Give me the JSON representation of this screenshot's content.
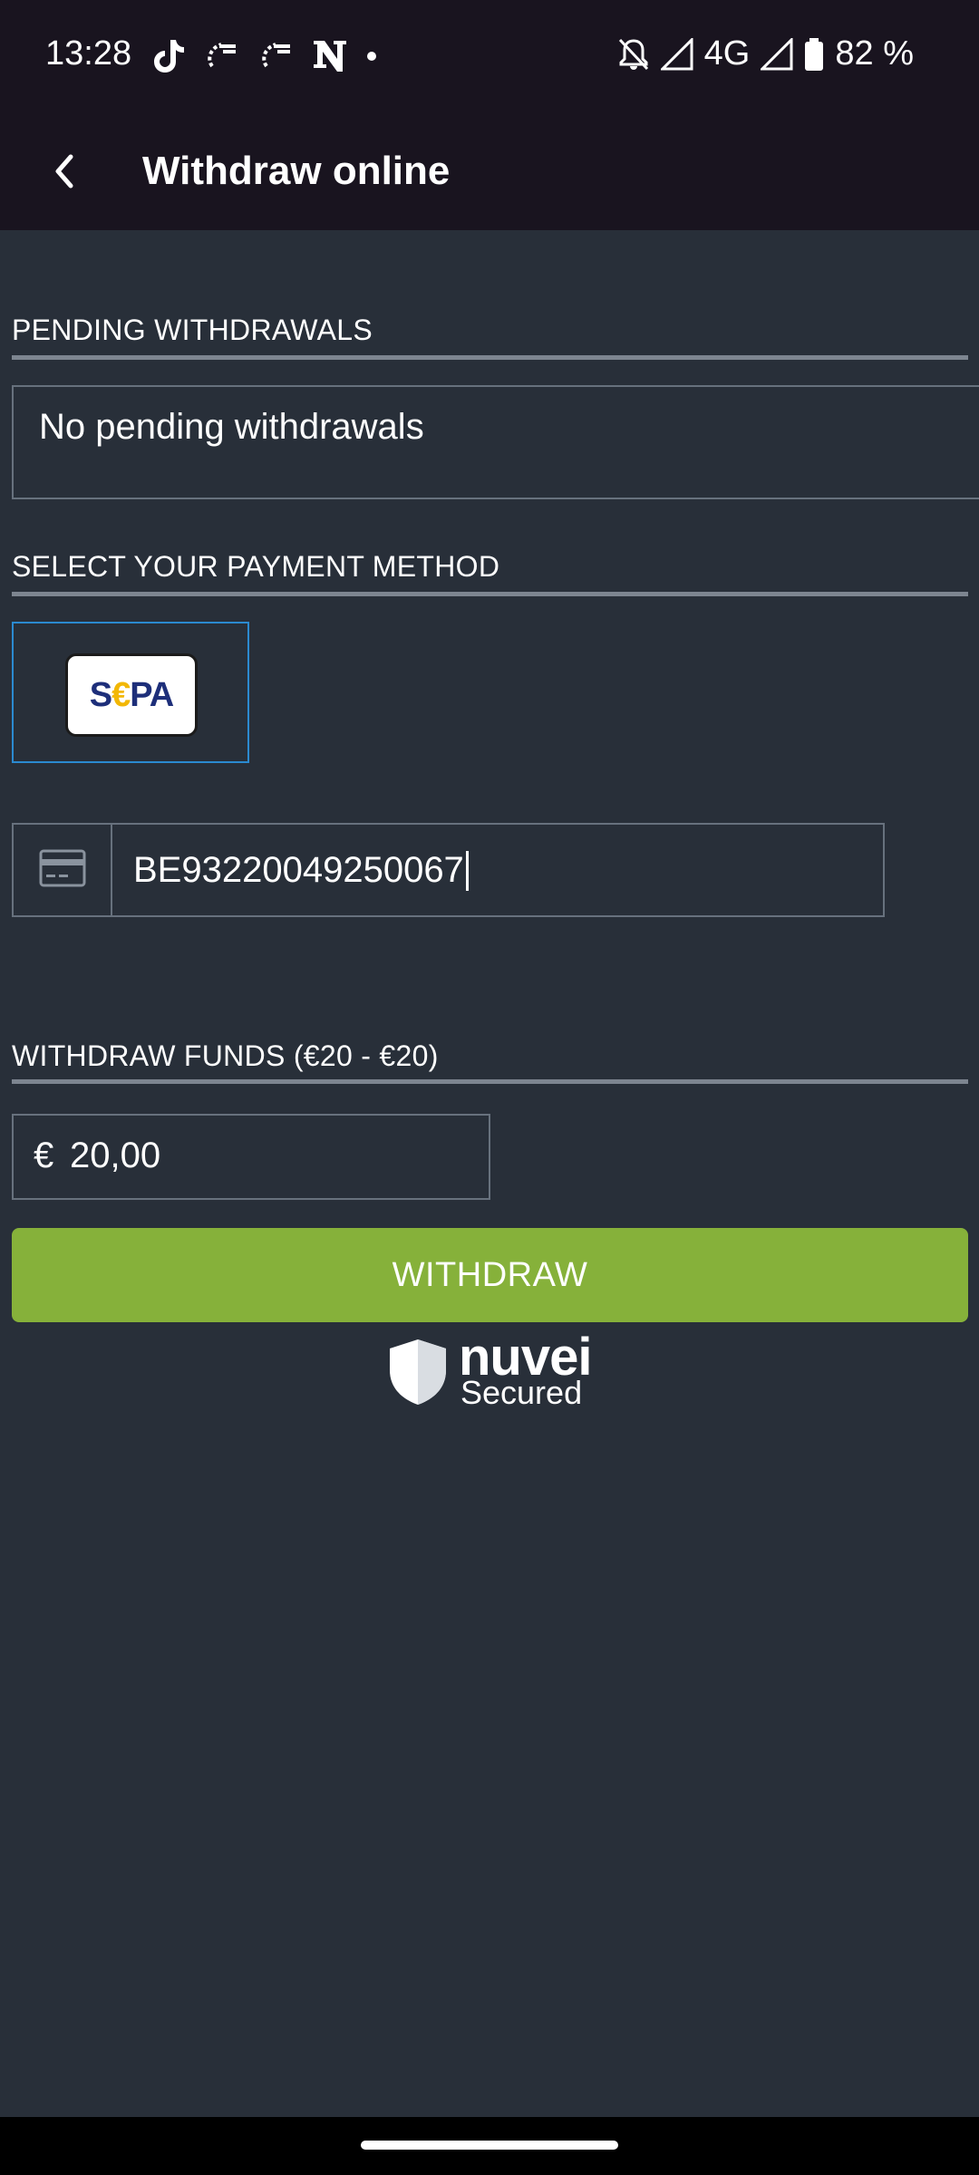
{
  "status_bar": {
    "time": "13:28",
    "network": "4G",
    "battery": "82 %",
    "left_icons": [
      "tiktok-icon",
      "app-icon",
      "app-icon",
      "n-app-icon",
      "more-dot-icon"
    ],
    "right_icons": [
      "muted-bell-icon",
      "signal-icon",
      "signal-icon",
      "battery-icon"
    ]
  },
  "app_bar": {
    "title": "Withdraw online",
    "back_icon": "chevron-left-icon"
  },
  "pending": {
    "section_label": "PENDING WITHDRAWALS",
    "empty_text": "No pending withdrawals"
  },
  "payment": {
    "section_label": "SELECT YOUR PAYMENT METHOD",
    "method_logo": {
      "part1": "S",
      "euro": "€",
      "part2": "PA"
    },
    "selected_color": "#2b8ad0",
    "iban_icon": "credit-card-icon",
    "iban_value": "BE93220049250067"
  },
  "withdraw": {
    "section_label": "WITHDRAW FUNDS (€20 - €20)",
    "currency_symbol": "€",
    "amount_value": "20,00",
    "button_label": "WITHDRAW",
    "button_color": "#86b13a"
  },
  "security_badge": {
    "brand": "nuvei",
    "label": "Secured",
    "icon": "shield-icon"
  },
  "colors": {
    "background": "#282f39",
    "app_bar": "#19141f",
    "border": "#67717d"
  }
}
